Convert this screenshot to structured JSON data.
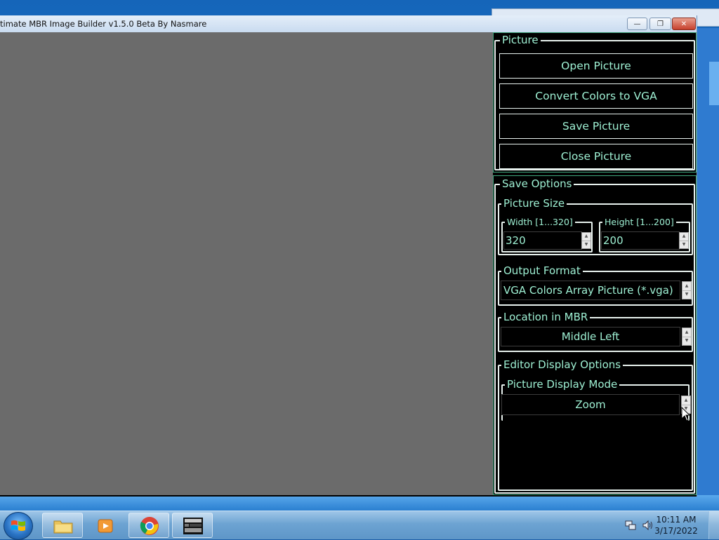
{
  "window": {
    "title": "timate MBR Image Builder v1.5.0 Beta By Nasmare"
  },
  "picture_group": {
    "legend": "Picture",
    "open_label": "Open Picture",
    "convert_label": "Convert Colors to VGA",
    "save_label": "Save Picture",
    "close_label": "Close Picture"
  },
  "save_options": {
    "legend": "Save Options",
    "picture_size": {
      "legend": "Picture Size",
      "width_legend": "Width [1...320]",
      "width_value": "320",
      "height_legend": "Height [1...200]",
      "height_value": "200"
    },
    "output_format": {
      "legend": "Output Format",
      "value": "VGA Colors Array Picture (*.vga)"
    },
    "location": {
      "legend": "Location in MBR",
      "value": "Middle Left"
    },
    "editor_display": {
      "legend": "Editor Display Options",
      "mode_legend": "Picture Display Mode",
      "mode_value": "Zoom"
    }
  },
  "taskbar": {
    "time": "10:11 AM",
    "date": "3/17/2022"
  },
  "colors": {
    "panel_text": "#9ef0d3",
    "canvas_gray": "#6b6b6b"
  }
}
